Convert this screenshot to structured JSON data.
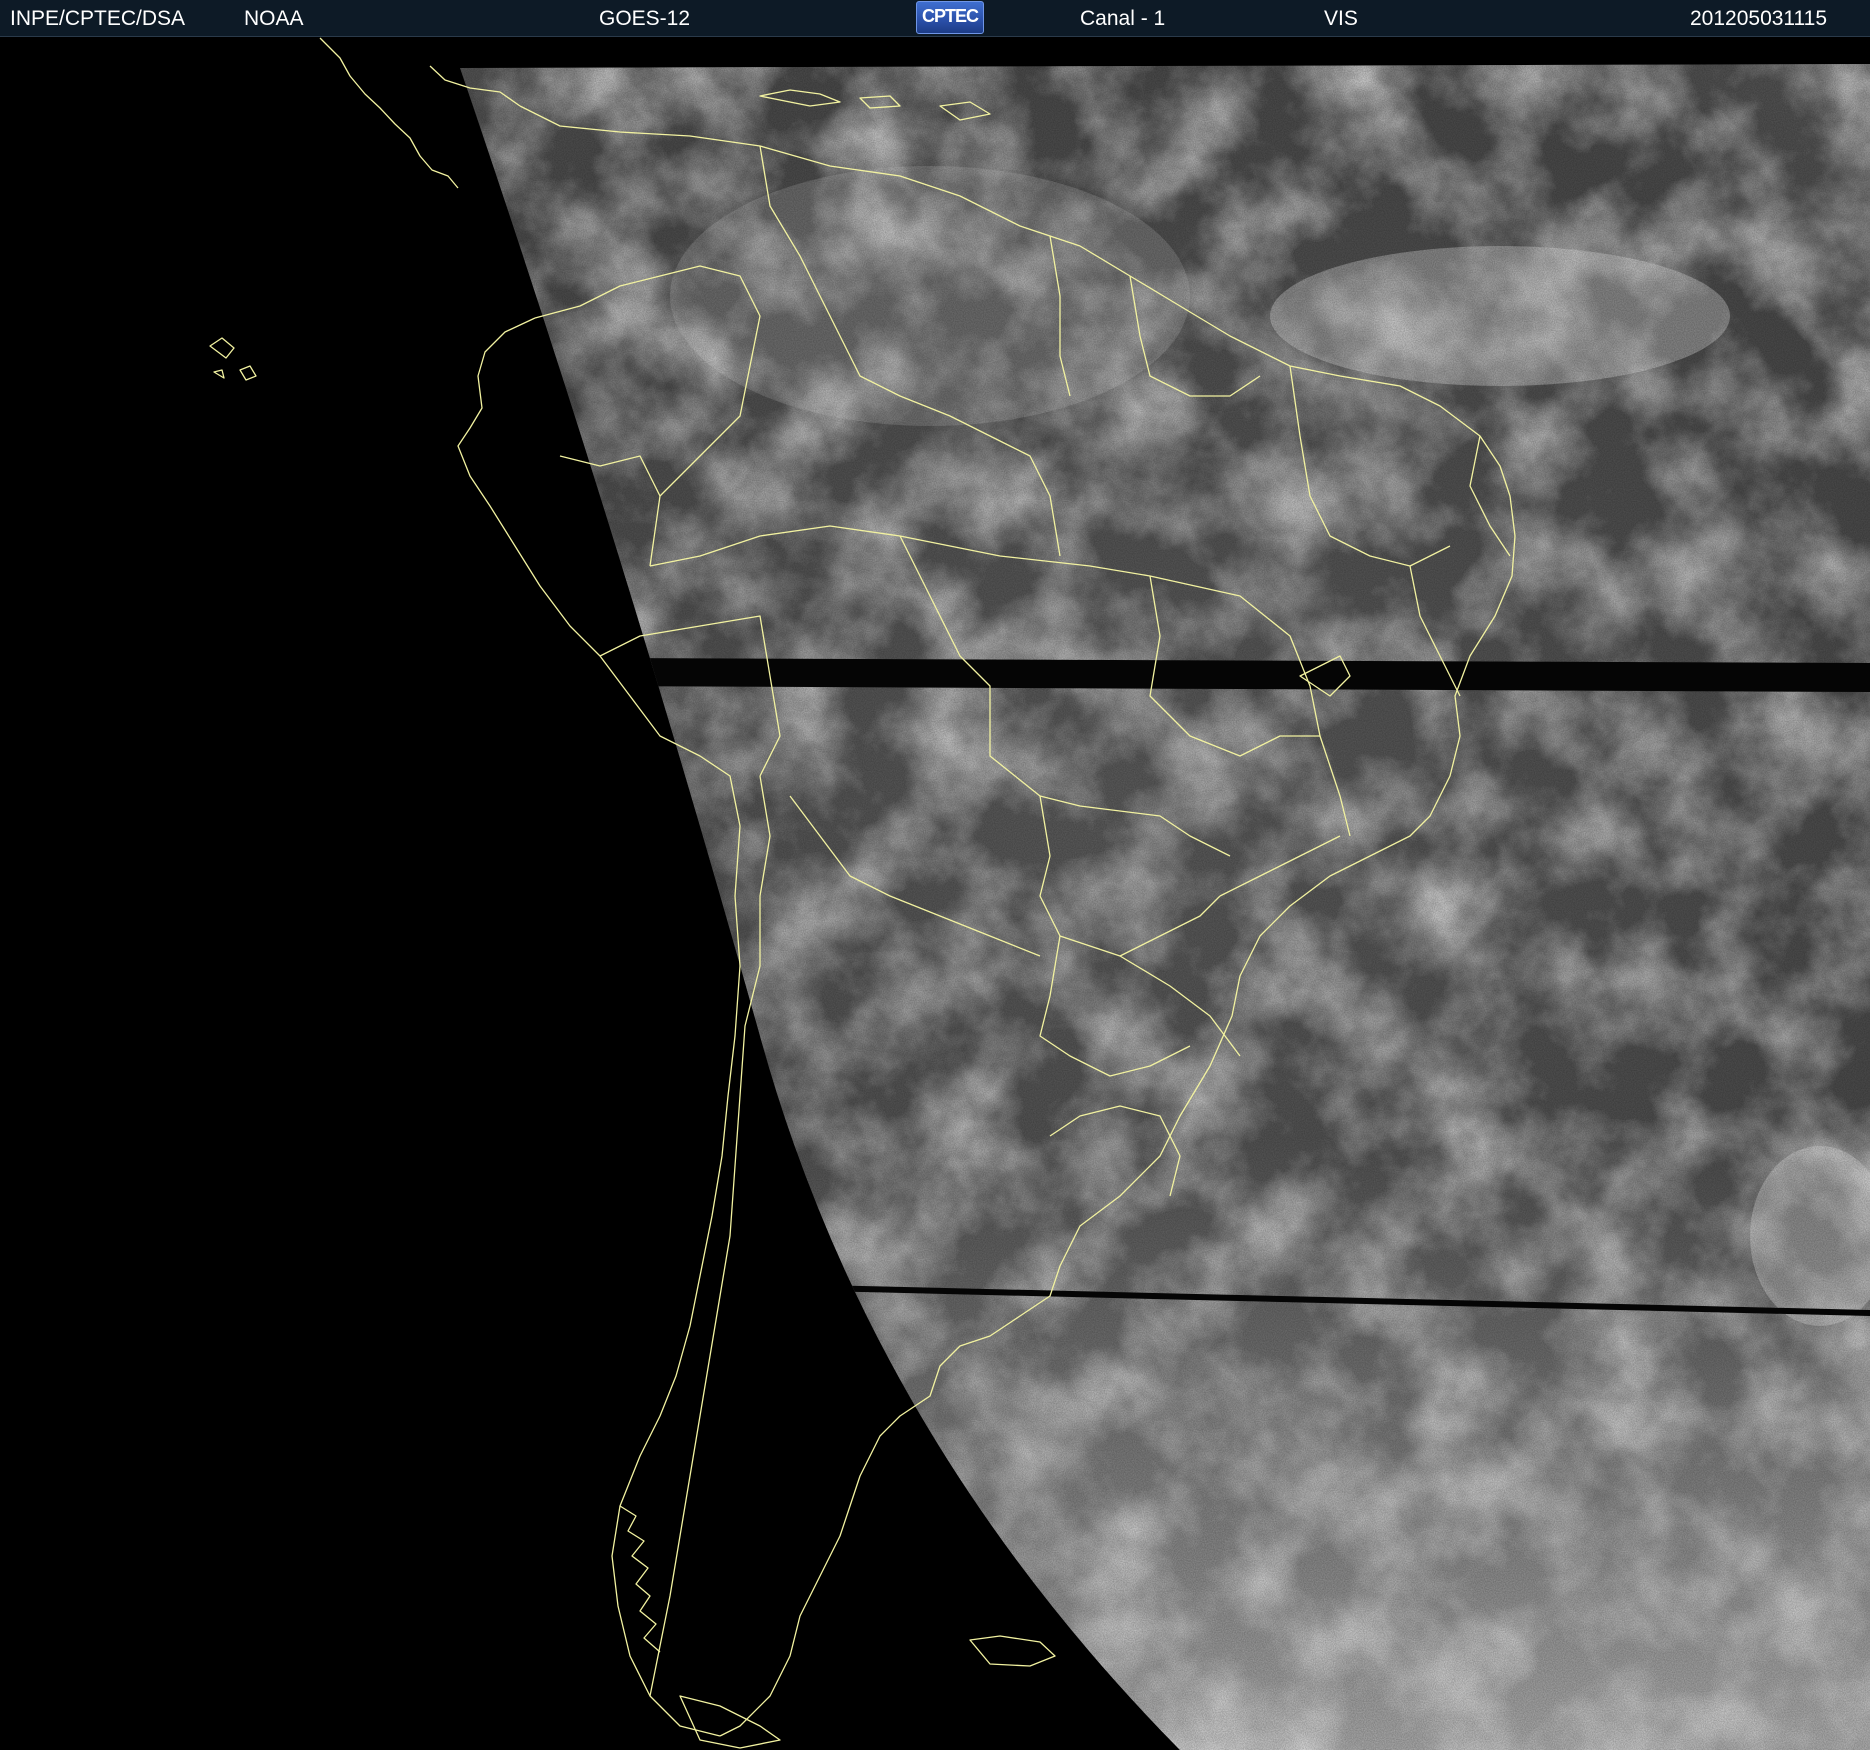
{
  "header": {
    "agency": "INPE/CPTEC/DSA",
    "partner": "NOAA",
    "satellite": "GOES-12",
    "logo_text": "CPTEC",
    "channel": "Canal - 1",
    "band": "VIS",
    "timestamp": "201205031115"
  },
  "colors": {
    "background": "#000000",
    "header_bg": "#0d1a26",
    "header_text": "#ffffff",
    "border_lines": "#f2f2a0",
    "cloud": "#e8e8e8",
    "surface": "#5a5a5a"
  },
  "map": {
    "type": "satellite-visible-imagery",
    "region": "south-america",
    "overlay": "political-borders"
  }
}
